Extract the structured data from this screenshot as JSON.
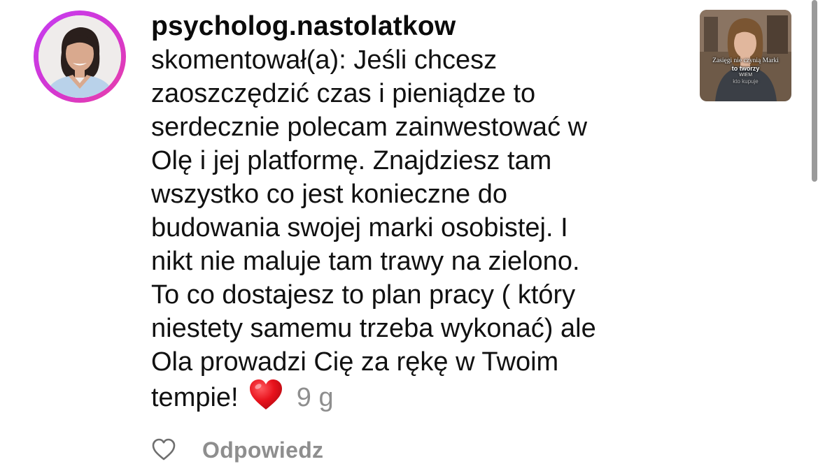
{
  "comment": {
    "username": "psycholog.nastolatkow",
    "lines": [
      "skomentował(a): Jeśli chcesz",
      "zaoszczędzić czas i pieniądze to",
      "serdecznie polecam zainwestować w",
      "Olę i jej platformę. Znajdziesz tam",
      "wszystko co jest konieczne do",
      "budowania swojej marki osobistej. I",
      "nikt nie maluje tam trawy na zielono.",
      "To co dostajesz to plan pracy ( który",
      "niestety samemu trzeba wykonać) ale",
      "Ola prowadzi Cię za rękę w Twoim"
    ],
    "last_line": "tempie!",
    "emoji": "red-heart-emoji",
    "timestamp": "9 g"
  },
  "thumbnail": {
    "caption_line1": "Zasięgi nie czynią Marki",
    "caption_line2": "to tworzy",
    "caption_line3": "WIEM",
    "caption_line4": "kto kupuje"
  },
  "actions": {
    "like_icon": "heart-outline-icon",
    "reply_label": "Odpowiedz"
  },
  "colors": {
    "avatar_ring": "#d23ad6",
    "secondary_text": "#8e8e8e",
    "emoji_heart": "#e0121b"
  }
}
